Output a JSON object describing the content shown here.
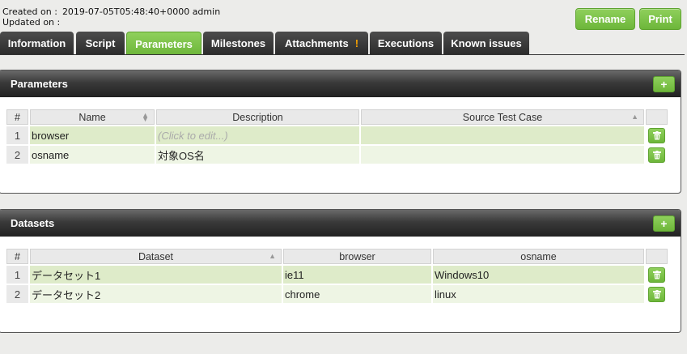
{
  "meta": {
    "created_label": "Created on :",
    "created_value": "2019-07-05T05:48:40+0000 admin",
    "updated_label": "Updated on :"
  },
  "actions": {
    "rename": "Rename",
    "print": "Print"
  },
  "tabs": [
    {
      "label": "Information"
    },
    {
      "label": "Script"
    },
    {
      "label": "Parameters",
      "active": true
    },
    {
      "label": "Milestones"
    },
    {
      "label": "Attachments",
      "badge": "!"
    },
    {
      "label": "Executions"
    },
    {
      "label": "Known issues"
    }
  ],
  "parameters": {
    "title": "Parameters",
    "add_label": "+",
    "columns": [
      "#",
      "Name",
      "Description",
      "Source Test Case"
    ],
    "rows": [
      {
        "num": "1",
        "name": "browser",
        "description": "(Click to edit...)",
        "source": ""
      },
      {
        "num": "2",
        "name": "osname",
        "description": "対象OS名",
        "source": ""
      }
    ]
  },
  "datasets": {
    "title": "Datasets",
    "add_label": "+",
    "columns": [
      "#",
      "Dataset",
      "browser",
      "osname"
    ],
    "rows": [
      {
        "num": "1",
        "dataset": "データセット1",
        "browser": "ie11",
        "osname": "Windows10"
      },
      {
        "num": "2",
        "dataset": "データセット2",
        "browser": "chrome",
        "osname": "linux"
      }
    ]
  },
  "colors": {
    "accent": "#7ac142",
    "tab_dark": "#333333",
    "row_selected": "#deebc9",
    "row_alt": "#eef5e4"
  },
  "icons": {
    "delete": "trash-icon",
    "sort": "sort-icon"
  }
}
